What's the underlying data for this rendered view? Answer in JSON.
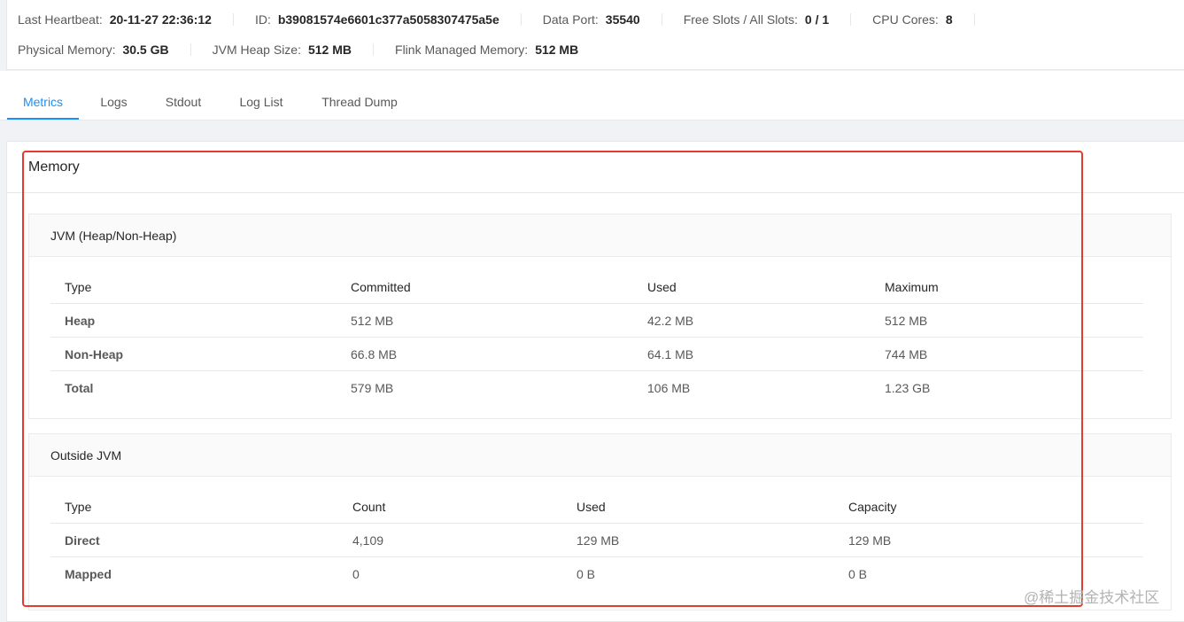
{
  "info": {
    "row1": [
      {
        "label": "Last Heartbeat:",
        "value": "20-11-27 22:36:12"
      },
      {
        "label": "ID:",
        "value": "b39081574e6601c377a5058307475a5e"
      },
      {
        "label": "Data Port:",
        "value": "35540"
      },
      {
        "label": "Free Slots / All Slots:",
        "value": "0 / 1"
      },
      {
        "label": "CPU Cores:",
        "value": "8"
      }
    ],
    "row2": [
      {
        "label": "Physical Memory:",
        "value": "30.5 GB"
      },
      {
        "label": "JVM Heap Size:",
        "value": "512 MB"
      },
      {
        "label": "Flink Managed Memory:",
        "value": "512 MB"
      }
    ]
  },
  "tabs": [
    {
      "label": "Metrics",
      "active": true
    },
    {
      "label": "Logs",
      "active": false
    },
    {
      "label": "Stdout",
      "active": false
    },
    {
      "label": "Log List",
      "active": false
    },
    {
      "label": "Thread Dump",
      "active": false
    }
  ],
  "memory": {
    "title": "Memory",
    "jvm": {
      "title": "JVM (Heap/Non-Heap)",
      "columns": [
        "Type",
        "Committed",
        "Used",
        "Maximum"
      ],
      "rows": [
        [
          "Heap",
          "512 MB",
          "42.2 MB",
          "512 MB"
        ],
        [
          "Non-Heap",
          "66.8 MB",
          "64.1 MB",
          "744 MB"
        ],
        [
          "Total",
          "579 MB",
          "106 MB",
          "1.23 GB"
        ]
      ]
    },
    "outside": {
      "title": "Outside JVM",
      "columns": [
        "Type",
        "Count",
        "Used",
        "Capacity"
      ],
      "rows": [
        [
          "Direct",
          "4,109",
          "129 MB",
          "129 MB"
        ],
        [
          "Mapped",
          "0",
          "0 B",
          "0 B"
        ]
      ]
    }
  },
  "watermark": "@稀土掘金技术社区",
  "colors": {
    "accent": "#1890ff",
    "highlight": "#e53b2d"
  }
}
